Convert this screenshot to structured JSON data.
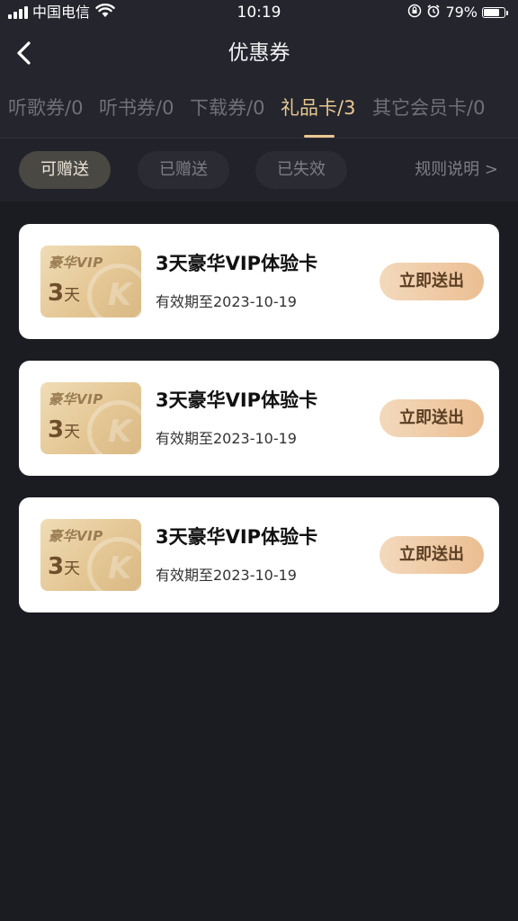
{
  "status_bar": {
    "carrier": "中国电信",
    "time": "10:19",
    "battery_pct": "79%",
    "battery_level": 0.79
  },
  "nav": {
    "title": "优惠券"
  },
  "tabs": [
    {
      "label": "听歌券/0",
      "active": false
    },
    {
      "label": "听书券/0",
      "active": false
    },
    {
      "label": "下载券/0",
      "active": false
    },
    {
      "label": "礼品卡/3",
      "active": true
    },
    {
      "label": "其它会员卡/0",
      "active": false
    }
  ],
  "filters": {
    "chips": [
      {
        "label": "可赠送",
        "active": true
      },
      {
        "label": "已赠送",
        "active": false
      },
      {
        "label": "已失效",
        "active": false
      }
    ],
    "rules_label": "规则说明 >"
  },
  "cards": [
    {
      "thumb_brand": "豪华VIP",
      "thumb_days": "3",
      "thumb_unit": "天",
      "title": "3天豪华VIP体验卡",
      "expiry": "有效期至2023-10-19",
      "action": "立即送出"
    },
    {
      "thumb_brand": "豪华VIP",
      "thumb_days": "3",
      "thumb_unit": "天",
      "title": "3天豪华VIP体验卡",
      "expiry": "有效期至2023-10-19",
      "action": "立即送出"
    },
    {
      "thumb_brand": "豪华VIP",
      "thumb_days": "3",
      "thumb_unit": "天",
      "title": "3天豪华VIP体验卡",
      "expiry": "有效期至2023-10-19",
      "action": "立即送出"
    }
  ],
  "colors": {
    "background": "#1b1c21",
    "header": "#24252d",
    "accent_gold": "#e8c892",
    "card": "#ffffff"
  }
}
